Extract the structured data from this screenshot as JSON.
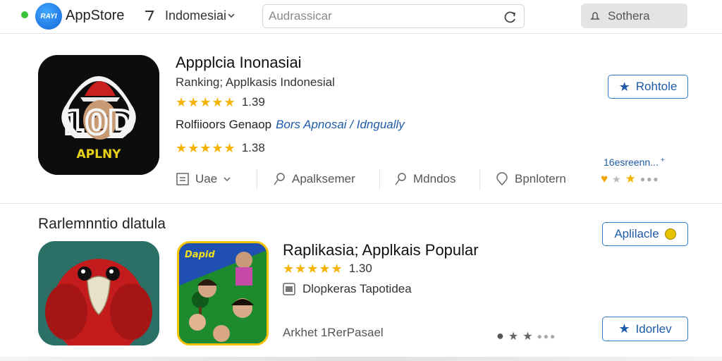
{
  "colors": {
    "accent": "#2e7cc9",
    "link": "#1f5aa8",
    "star": "#f5b300",
    "status": "#3cc33c"
  },
  "topbar": {
    "logo_text": "RAYI",
    "brand": "AppStore",
    "region": "Indomesiai",
    "search_placeholder": "Audrassicar",
    "account_label": "Sothera"
  },
  "featured": {
    "title": "Appplcia Inonasiai",
    "subtitle": "Ranking; Applkasis Indonesial",
    "rating_stars": 5,
    "rating_value": "1.39",
    "publisher_prefix": "Rolfiioors Genaop",
    "publisher_link": "Bors Apnosai / Idngually",
    "rating2_stars": 5,
    "rating2_value": "1.38",
    "primary_button": "Rohtole",
    "actions": [
      {
        "label": "Uae",
        "icon": "list-icon"
      },
      {
        "label": "Apalksemer",
        "icon": "pin-icon"
      },
      {
        "label": "Mdndos",
        "icon": "pin-icon"
      },
      {
        "label": "Bpnlotern",
        "icon": "location-icon"
      }
    ],
    "reviews_link": "16esreenn...",
    "icon_text_top": "10D",
    "icon_text_bottom": "APLNY"
  },
  "popular": {
    "heading": "Rarlemnntio dlatula",
    "section_button": "Aplilacle",
    "title": "Raplikasia; Applkais Popular",
    "rating_stars": 5,
    "rating_value": "1.30",
    "developer": "Dlopkeras Tapotidea",
    "category": "Arkhet 1RerPasael",
    "secondary_button": "Idorlev",
    "thumb_b_text": "Dapid"
  }
}
